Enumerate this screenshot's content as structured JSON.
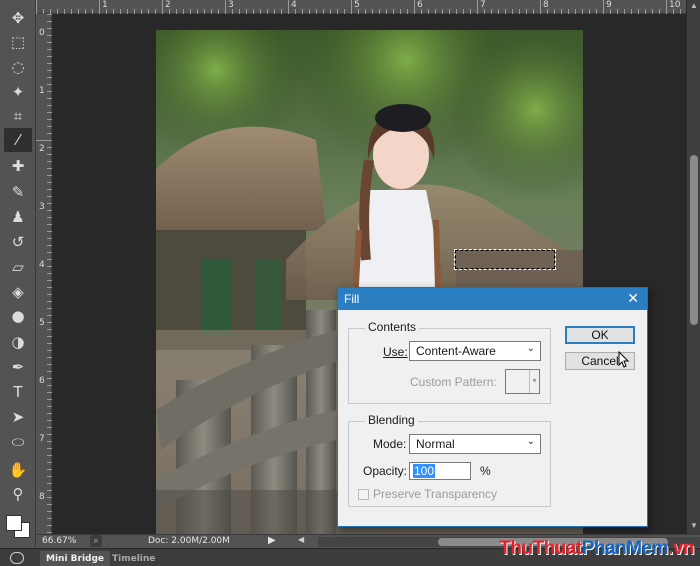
{
  "toolbar": {
    "tools": [
      {
        "name": "move-tool-icon",
        "glyph": "✥"
      },
      {
        "name": "rectangular-marquee-icon",
        "glyph": "⬚"
      },
      {
        "name": "lasso-icon",
        "glyph": "◌"
      },
      {
        "name": "magic-wand-icon",
        "glyph": "✦"
      },
      {
        "name": "crop-icon",
        "glyph": "⌗"
      },
      {
        "name": "eyedropper-icon",
        "glyph": "⁄"
      },
      {
        "name": "healing-brush-icon",
        "glyph": "✚"
      },
      {
        "name": "brush-icon",
        "glyph": "✎"
      },
      {
        "name": "clone-stamp-icon",
        "glyph": "♟"
      },
      {
        "name": "history-brush-icon",
        "glyph": "↺"
      },
      {
        "name": "eraser-icon",
        "glyph": "▱"
      },
      {
        "name": "paint-bucket-icon",
        "glyph": "◈"
      },
      {
        "name": "blur-icon",
        "glyph": "●"
      },
      {
        "name": "dodge-icon",
        "glyph": "◑"
      },
      {
        "name": "pen-icon",
        "glyph": "✒"
      },
      {
        "name": "type-icon",
        "glyph": "T"
      },
      {
        "name": "path-selection-icon",
        "glyph": "➤"
      },
      {
        "name": "ellipse-icon",
        "glyph": "⬭"
      },
      {
        "name": "hand-icon",
        "glyph": "✋"
      },
      {
        "name": "zoom-icon",
        "glyph": "⚲"
      }
    ],
    "active_tool": "eyedropper-icon",
    "foreground_color": "#ffffff",
    "background_color": "#ffffff"
  },
  "rulers": {
    "top_numbers": [
      "1",
      "2",
      "3",
      "4",
      "5",
      "6",
      "7",
      "8",
      "9",
      "10"
    ],
    "left_numbers": [
      "0",
      "1",
      "2",
      "3",
      "4",
      "5",
      "6",
      "7",
      "8"
    ]
  },
  "status": {
    "zoom": "66.67%",
    "doc_info": "Doc: 2.00M/2.00M"
  },
  "bottom_tabs": [
    {
      "label": "Mini Bridge",
      "active": true
    },
    {
      "label": "Timeline",
      "active": false
    }
  ],
  "watermark": {
    "part1": "ThuThuat",
    "part2": "PhanMem",
    "part3": ".vn",
    "color1": "#e5222b",
    "color2": "#1565c0"
  },
  "dialog": {
    "title": "Fill",
    "contents_group": "Contents",
    "use_label": "Use:",
    "use_value": "Content-Aware",
    "custom_pattern_label": "Custom Pattern:",
    "blending_group": "Blending",
    "mode_label": "Mode:",
    "mode_value": "Normal",
    "opacity_label": "Opacity:",
    "opacity_value": "100",
    "opacity_unit": "%",
    "preserve_label": "Preserve Transparency",
    "ok_label": "OK",
    "cancel_label": "Cancel",
    "close_glyph": "✕"
  }
}
